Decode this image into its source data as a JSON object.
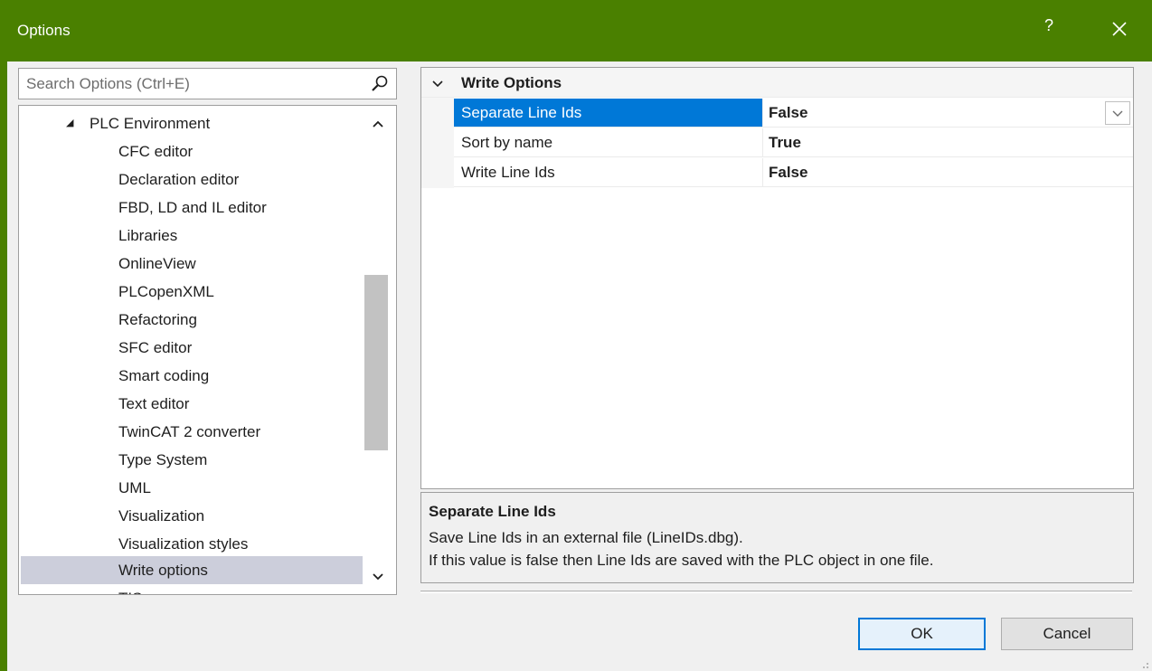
{
  "window": {
    "title": "Options",
    "help_label": "?",
    "accent_color": "#4a8000"
  },
  "search": {
    "placeholder": "Search Options (Ctrl+E)",
    "value": ""
  },
  "tree": {
    "parent": {
      "label": "PLC Environment",
      "arrow": "◢"
    },
    "items": [
      {
        "label": "CFC editor"
      },
      {
        "label": "Declaration editor"
      },
      {
        "label": "FBD, LD and IL editor"
      },
      {
        "label": "Libraries"
      },
      {
        "label": "OnlineView"
      },
      {
        "label": "PLCopenXML"
      },
      {
        "label": "Refactoring"
      },
      {
        "label": "SFC editor"
      },
      {
        "label": "Smart coding"
      },
      {
        "label": "Text editor"
      },
      {
        "label": "TwinCAT 2 converter"
      },
      {
        "label": "Type System"
      },
      {
        "label": "UML"
      },
      {
        "label": "Visualization"
      },
      {
        "label": "Visualization styles"
      },
      {
        "label": "Write options",
        "selected": true
      },
      {
        "label": "TIS ... ... ..."
      }
    ]
  },
  "grid": {
    "category": "Write Options",
    "properties": [
      {
        "name": "Separate Line Ids",
        "value": "False",
        "selected": true
      },
      {
        "name": "Sort by name",
        "value": "True"
      },
      {
        "name": "Write Line Ids",
        "value": "False"
      }
    ],
    "selection_color": "#0078d7"
  },
  "description": {
    "title": "Separate Line Ids",
    "line1": "Save Line Ids in an external file (LineIDs.dbg).",
    "line2": "If this value is false then Line Ids are saved with the PLC object in one file."
  },
  "buttons": {
    "ok": "OK",
    "cancel": "Cancel"
  }
}
